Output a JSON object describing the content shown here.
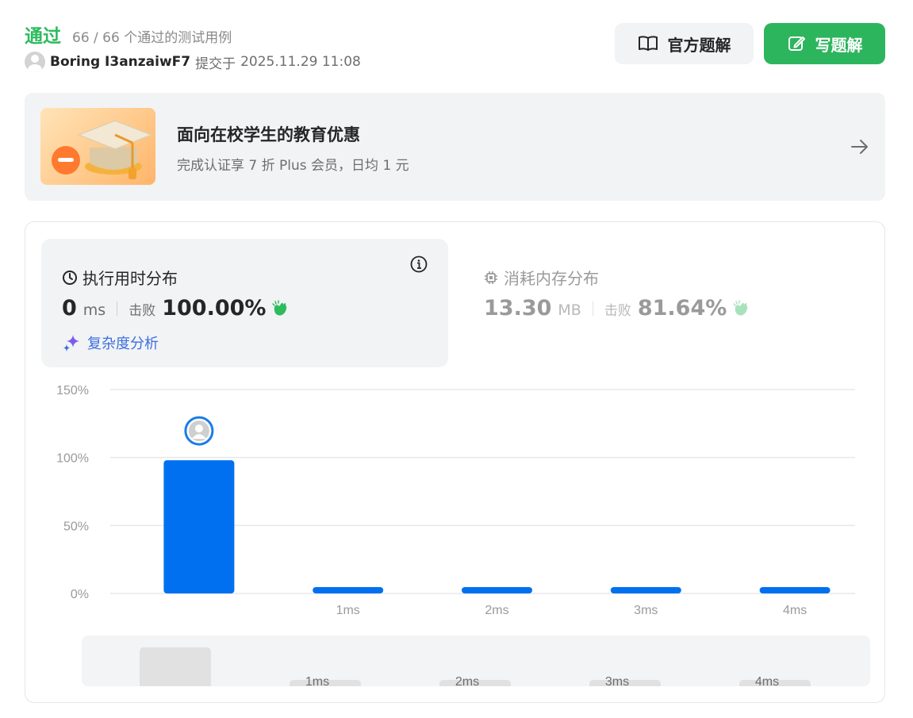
{
  "header": {
    "status": "通过",
    "testcases": "66 / 66 个通过的测试用例",
    "username": "Boring I3anzaiwF7",
    "submitted_label": "提交于",
    "submitted_time": "2025.11.29 11:08"
  },
  "buttons": {
    "official_solution": "官方题解",
    "write_solution": "写题解"
  },
  "promo": {
    "title": "面向在校学生的教育优惠",
    "subtitle": "完成认证享 7 折 Plus 会员，日均 1 元"
  },
  "runtime": {
    "title": "执行用时分布",
    "value": "0",
    "unit": "ms",
    "beat_label": "击败",
    "beat_value": "100.00%",
    "analysis_link": "复杂度分析"
  },
  "memory": {
    "title": "消耗内存分布",
    "value": "13.30",
    "unit": "MB",
    "beat_label": "击败",
    "beat_value": "81.64%"
  },
  "colors": {
    "accept": "#2cbb5d",
    "bar": "#0070f0",
    "link": "#3a6fe0"
  },
  "chart_data": {
    "type": "bar",
    "categories": [
      "",
      "1ms",
      "2ms",
      "3ms",
      "4ms"
    ],
    "values": [
      98,
      2,
      2,
      2,
      2
    ],
    "y_ticks": [
      "0%",
      "50%",
      "100%",
      "150%"
    ],
    "ylim": [
      0,
      150
    ],
    "unit": "%",
    "highlighted_index": 0,
    "grid": true,
    "minimap_categories": [
      "",
      "1ms",
      "2ms",
      "3ms",
      "4ms"
    ]
  }
}
